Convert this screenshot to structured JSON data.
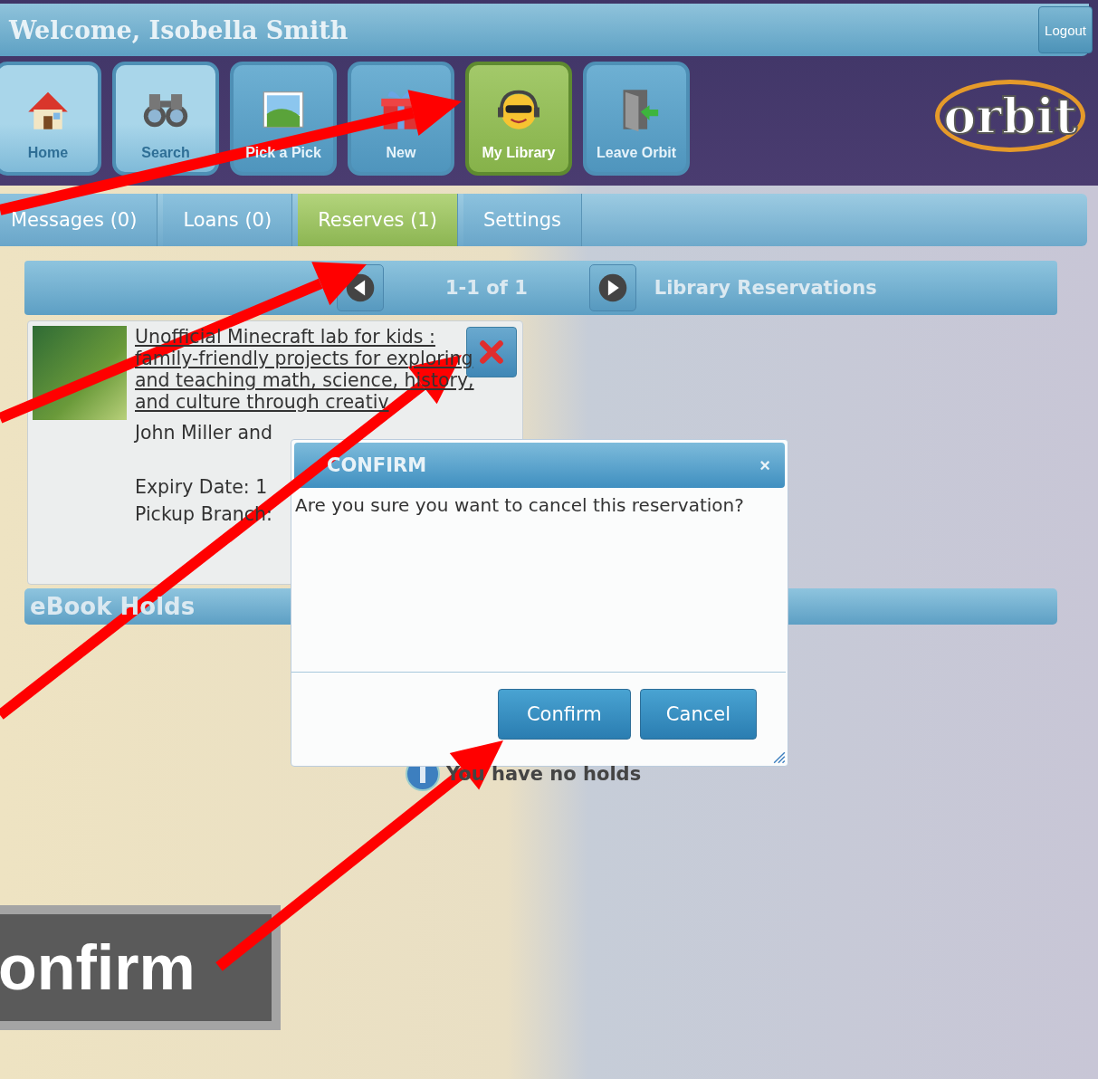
{
  "header": {
    "title": "Welcome, Isobella Smith",
    "logout": "Logout"
  },
  "nav": [
    {
      "label": "Home",
      "kind": "home",
      "selected": false
    },
    {
      "label": "Search",
      "kind": "search",
      "selected": false
    },
    {
      "label": "Pick a Pick",
      "kind": "picture",
      "selected": false
    },
    {
      "label": "New",
      "kind": "gift",
      "selected": false
    },
    {
      "label": "My Library",
      "kind": "smiley",
      "selected": true
    },
    {
      "label": "Leave Orbit",
      "kind": "door",
      "selected": false
    }
  ],
  "logo": "orbit",
  "tabs": [
    {
      "label": "Messages (0)",
      "selected": false
    },
    {
      "label": "Loans (0)",
      "selected": false
    },
    {
      "label": "Reserves (1)",
      "selected": true
    },
    {
      "label": "Settings",
      "selected": false
    }
  ],
  "pager": {
    "range": "1-1 of 1",
    "title": "Library Reservations"
  },
  "reservations": [
    {
      "title": "Unofficial Minecraft lab for kids : family-friendly projects for exploring and teaching math, science, history, and culture through creativ",
      "author": "John Miller and",
      "expiry": "Expiry Date: 1",
      "branch": "Pickup Branch:"
    }
  ],
  "ebook_holds": {
    "title": "eBook Holds",
    "message": "You have no holds"
  },
  "dialog": {
    "title": "CONFIRM",
    "close": "×",
    "message": "Are you sure you want to cancel this reservation?",
    "buttons": [
      "Confirm",
      "Cancel"
    ]
  },
  "callout": {
    "text": "onfirm"
  }
}
